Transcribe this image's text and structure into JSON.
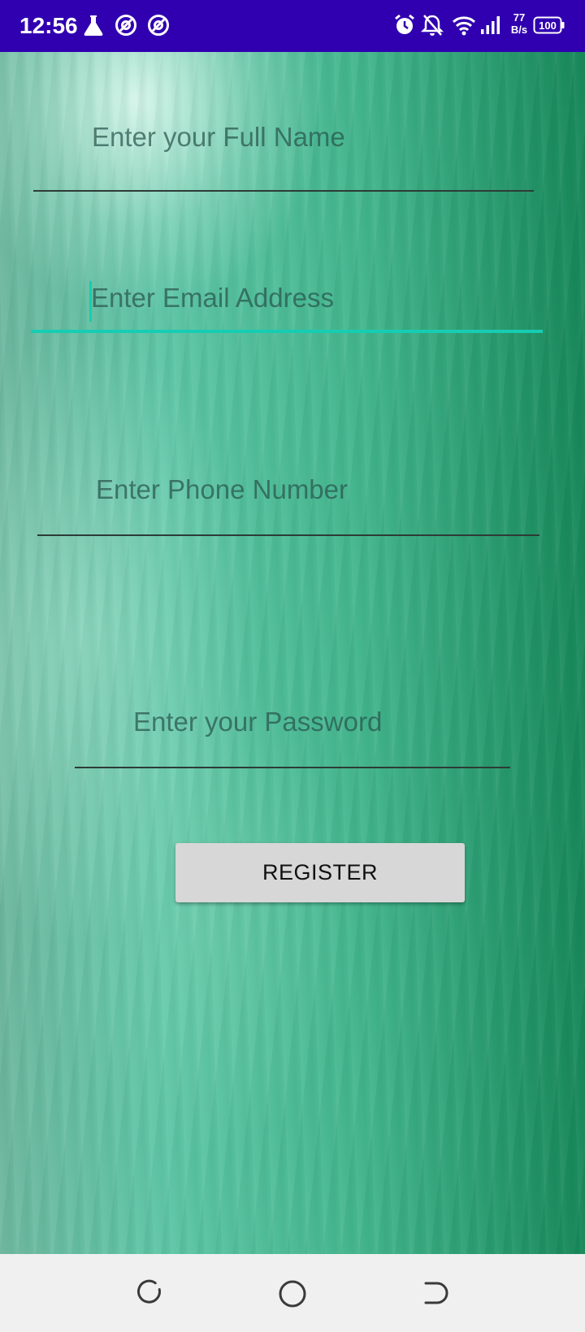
{
  "status_bar": {
    "time": "12:56",
    "speed_value": "77",
    "speed_unit": "B/s",
    "battery": "100",
    "icons": [
      "flask-icon",
      "at-sign-icon",
      "at-sign-icon",
      "alarm-icon",
      "bell-off-icon",
      "wifi-icon",
      "signal-icon",
      "battery-icon"
    ]
  },
  "form": {
    "full_name_placeholder": "Enter your Full Name",
    "email_placeholder": "Enter Email Address",
    "phone_placeholder": "Enter Phone Number",
    "password_placeholder": "Enter your Password",
    "register_label": "REGISTER"
  },
  "navigation": {
    "buttons": [
      "recent-apps-icon",
      "home-icon",
      "back-icon"
    ]
  },
  "colors": {
    "status_bar": "#3000b0",
    "accent": "#16cdb3",
    "button_bg": "#d7d7d7",
    "nav_bar": "#f0f0f0"
  }
}
